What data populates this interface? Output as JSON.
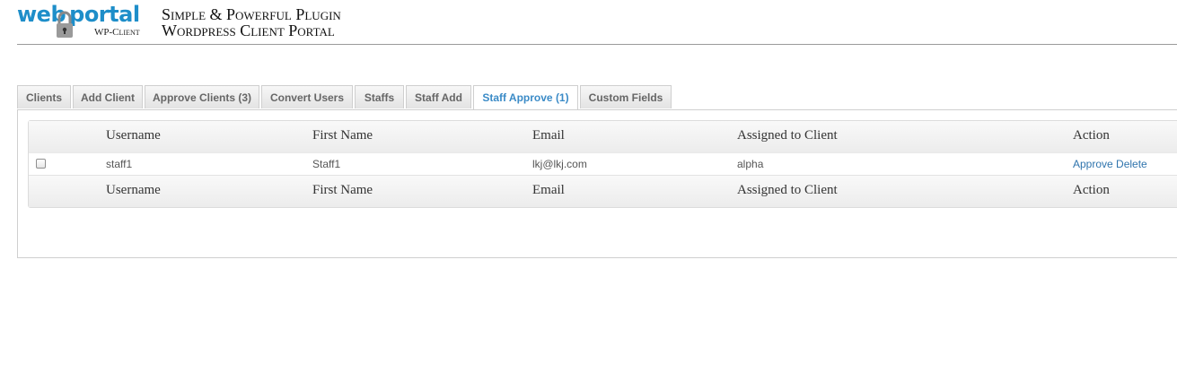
{
  "brand": {
    "logo_text_a": "web",
    "logo_text_b": "portal",
    "logo_sub": "WP-Client",
    "tagline_line1": "Simple & Powerful Plugin",
    "tagline_line2": "Wordpress Client Portal"
  },
  "tabs": [
    {
      "label": "Clients",
      "active": false
    },
    {
      "label": "Add Client",
      "active": false
    },
    {
      "label": "Approve Clients (3)",
      "active": false
    },
    {
      "label": "Convert Users",
      "active": false
    },
    {
      "label": "Staffs",
      "active": false
    },
    {
      "label": "Staff Add",
      "active": false
    },
    {
      "label": "Staff Approve (1)",
      "active": true
    },
    {
      "label": "Custom Fields",
      "active": false
    }
  ],
  "table": {
    "columns": [
      "Username",
      "First Name",
      "Email",
      "Assigned to Client",
      "Action"
    ],
    "rows": [
      {
        "checked": false,
        "username": "staff1",
        "first_name": "Staff1",
        "email": "lkj@lkj.com",
        "assigned_client": "alpha",
        "actions": [
          "Approve",
          "Delete"
        ]
      }
    ]
  },
  "colors": {
    "accent": "#3b8bc7",
    "brand_blue": "#1e8ec9",
    "link": "#2f74ad"
  }
}
